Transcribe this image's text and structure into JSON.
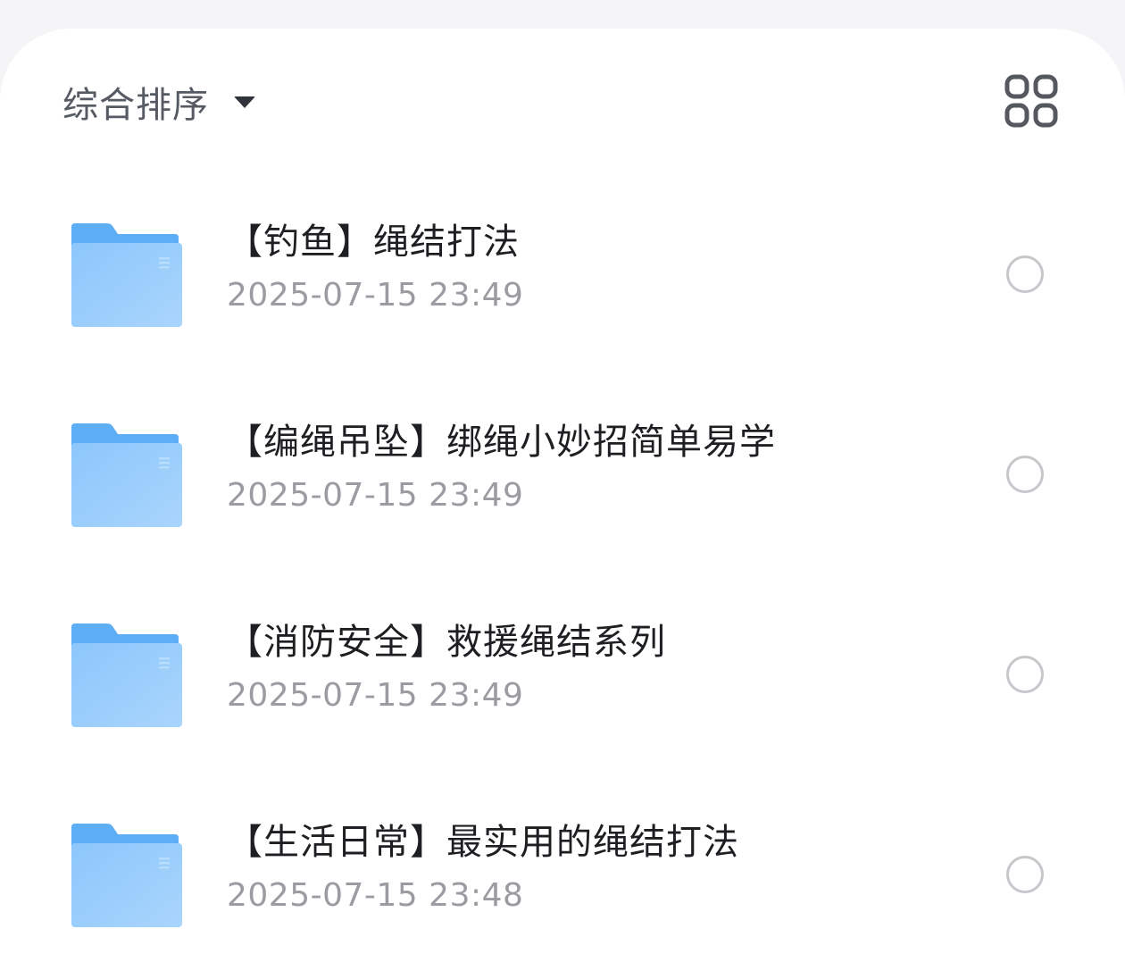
{
  "toolbar": {
    "sort_label": "综合排序",
    "sort_caret_icon": "caret-down-icon",
    "view_toggle_icon": "grid-view-icon"
  },
  "files": [
    {
      "name": "【钓鱼】绳结打法",
      "modified": "2025-07-15 23:49",
      "icon": "folder-icon",
      "selected": false
    },
    {
      "name": "【编绳吊坠】绑绳小妙招简单易学",
      "modified": "2025-07-15 23:49",
      "icon": "folder-icon",
      "selected": false
    },
    {
      "name": "【消防安全】救援绳结系列",
      "modified": "2025-07-15 23:49",
      "icon": "folder-icon",
      "selected": false
    },
    {
      "name": "【生活日常】最实用的绳结打法",
      "modified": "2025-07-15 23:48",
      "icon": "folder-icon",
      "selected": false
    }
  ],
  "colors": {
    "folder_back": "#5eaef5",
    "folder_front": "#8fc8fb",
    "radio_border": "#c7c8cc",
    "title_text": "#1e1f22",
    "time_text": "#9a9ca1"
  }
}
